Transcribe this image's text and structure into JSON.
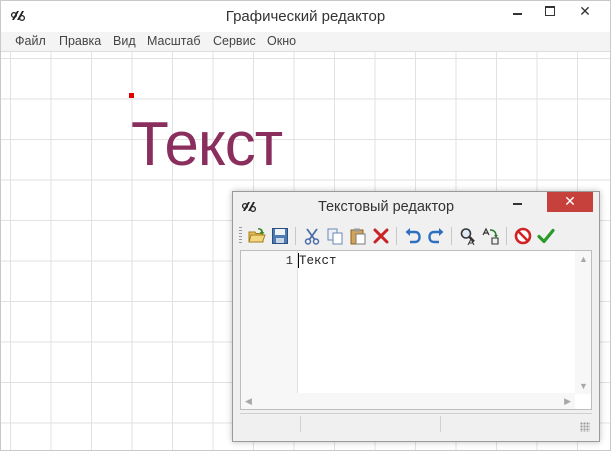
{
  "window": {
    "title": "Графический редактор",
    "close_glyph": "✕"
  },
  "menu": {
    "items": [
      "Файл",
      "Правка",
      "Вид",
      "Масштаб",
      "Сервис",
      "Окно"
    ]
  },
  "canvas": {
    "text": "Текст",
    "text_color": "#8a2e5e",
    "anchor_color": "#e00000"
  },
  "editor": {
    "title": "Текстовый редактор",
    "close_glyph": "✕",
    "toolbar": [
      "open-icon",
      "save-icon",
      "cut-icon",
      "copy-icon",
      "paste-icon",
      "delete-icon",
      "undo-icon",
      "redo-icon",
      "find-icon",
      "replace-icon",
      "cancel-icon",
      "ok-icon"
    ],
    "line_number": "1",
    "line_text": "Текст"
  }
}
